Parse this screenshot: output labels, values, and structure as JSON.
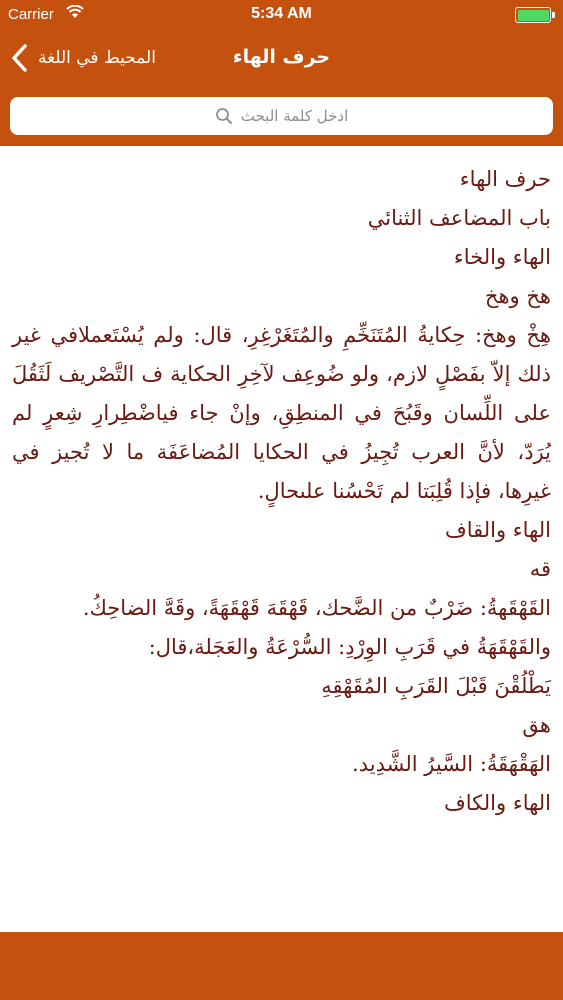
{
  "status_bar": {
    "carrier": "Carrier",
    "time": "5:34 AM",
    "battery_color": "#4cd964"
  },
  "nav": {
    "back_label": "المحيط في اللغة",
    "title": "حرف الهاء"
  },
  "search": {
    "placeholder": "ادخل كلمة البحث"
  },
  "content": {
    "line1": "حرف الهاء",
    "line2": "باب المضاعف الثنائي",
    "line3": "الهاء والخاء",
    "line4": "هخ وهخ",
    "para1": "هِخْ وهخ: حِكايةُ المُتَنَخِّمِ والمُتَغَرْغِرِ، قال: ولم يُسْتَعملافي غير ذلك إلاّ بفَصْلٍ لازم، ولو ضُوعِف لآخِرِ الحكاية ف التَّصْريف لَثَقُلَ على اللِّسان وقَبُحَ في المنطِقِ، وإنْ جاء فياضْطِرارِ شِعرٍ لم يُرَدّ، لأنَّ العرب تُجِيزُ في الحكايا المُضاعَفَة ما لا تُجيز في غيرِها، فإذا قُلِبَتا لم تَحْسُنا علىحالٍ.",
    "line5": "الهاء والقاف",
    "line6": "قه",
    "line7": "القَهْقَهةُ: ضَرْبٌ من الضَّحك، قَهْقَهَ قَهْقَهَةً، وقَهَّ الضاحِكُ.",
    "line8": "والقَهْقَهَةُ في قَرَبِ الوِرْدِ: السُّرْعَةُ والعَجَلة،قال:",
    "line9": "يَطْلُقْنَ قَبْلَ القَرَبِ المُقَهْقِهِ",
    "line10": "هق",
    "line11": "الهَقْهَقَةُ: السَّيرُ الشَّدِيد.",
    "line12": "الهاء والكاف"
  },
  "colors": {
    "bar": "#c4510e",
    "text": "#6b1a12"
  }
}
